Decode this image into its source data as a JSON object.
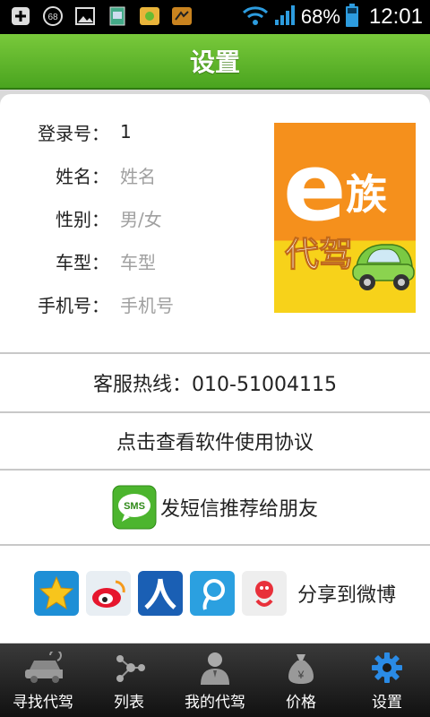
{
  "status_bar": {
    "notification_badge": "68",
    "battery": "68%",
    "time": "12:01"
  },
  "header": {
    "title": "设置"
  },
  "profile": {
    "login": {
      "label": "登录号：",
      "value": "1"
    },
    "name": {
      "label": "姓名：",
      "placeholder": "姓名"
    },
    "gender": {
      "label": "性别：",
      "placeholder": "男/女"
    },
    "car_model": {
      "label": "车型：",
      "placeholder": "车型"
    },
    "phone": {
      "label": "手机号：",
      "placeholder": "手机号"
    },
    "logo": {
      "big_letter": "e",
      "word1": "族",
      "word2": "代驾"
    }
  },
  "hotline": "客服热线：010-51004115",
  "agreement": "点击查看软件使用协议",
  "sms": {
    "icon_text": "SMS",
    "label": "发短信推荐给朋友"
  },
  "share": {
    "label": "分享到微博",
    "services": [
      "qzone-icon",
      "sina-weibo-icon",
      "renren-icon",
      "tencent-weibo-icon",
      "netease-weibo-icon"
    ]
  },
  "tabs": [
    {
      "label": "寻找代驾",
      "icon": "car-icon"
    },
    {
      "label": "列表",
      "icon": "list-nodes-icon"
    },
    {
      "label": "我的代驾",
      "icon": "driver-person-icon"
    },
    {
      "label": "价格",
      "icon": "money-bag-icon"
    },
    {
      "label": "设置",
      "icon": "gear-icon"
    }
  ],
  "colors": {
    "header_green": "#5cb82a",
    "active_tab": "#2a8be6"
  }
}
